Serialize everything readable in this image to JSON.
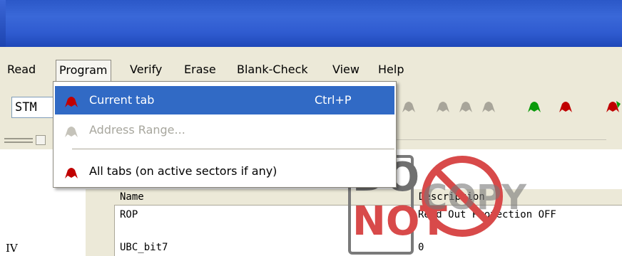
{
  "menubar": {
    "items": [
      {
        "label": "Read"
      },
      {
        "label": "Program"
      },
      {
        "label": "Verify"
      },
      {
        "label": "Erase"
      },
      {
        "label": "Blank-Check"
      },
      {
        "label": "View"
      },
      {
        "label": "Help"
      }
    ]
  },
  "toolbar": {
    "device_combo_value": "STM"
  },
  "program_menu": {
    "items": [
      {
        "label": "Current tab",
        "shortcut": "Ctrl+P",
        "state": "highlighted"
      },
      {
        "label": "Address Range...",
        "state": "disabled"
      },
      {
        "label": "All tabs (on active sectors if any)",
        "state": "enabled"
      }
    ]
  },
  "table": {
    "headers": {
      "name": "Name",
      "description": "Description"
    },
    "rows": [
      {
        "name": "ROP",
        "description": "Read Out Protection OFF"
      },
      {
        "name": "UBC_bit7",
        "description": "0"
      }
    ]
  },
  "left_panel": {
    "partial_label": "IV"
  },
  "watermark": {
    "line1": "DO",
    "line2": "NOT",
    "copy": "COPY"
  },
  "colors": {
    "title_bar": "#2b58c8",
    "menu_highlight": "#316ac5",
    "icon_red": "#b00000",
    "icon_green": "#008000",
    "icon_gray": "#a8a59a"
  }
}
